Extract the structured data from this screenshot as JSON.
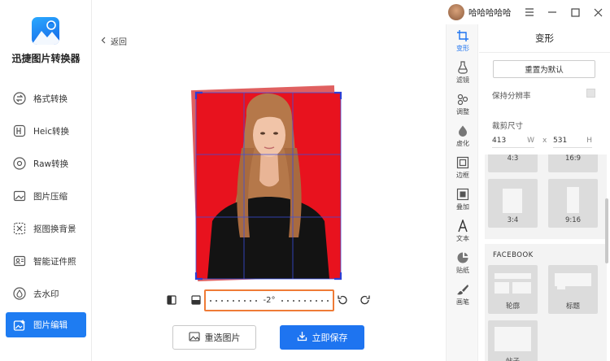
{
  "app": {
    "name": "迅捷图片转换器"
  },
  "sidebar": {
    "items": [
      {
        "label": "格式转换",
        "icon": "convert-icon"
      },
      {
        "label": "Heic转换",
        "icon": "heic-icon"
      },
      {
        "label": "Raw转换",
        "icon": "raw-icon"
      },
      {
        "label": "图片压缩",
        "icon": "compress-icon"
      },
      {
        "label": "抠图换背景",
        "icon": "cutout-icon"
      },
      {
        "label": "智能证件照",
        "icon": "id-photo-icon"
      },
      {
        "label": "去水印",
        "icon": "watermark-icon"
      },
      {
        "label": "图片编辑",
        "icon": "image-edit-icon"
      }
    ],
    "active_index": 7
  },
  "header": {
    "username": "哈哈哈哈哈"
  },
  "editor": {
    "back_label": "返回",
    "rotation_value": "-2°",
    "reselect_label": "重选图片",
    "save_label": "立即保存"
  },
  "tools": [
    {
      "label": "变形",
      "icon": "crop-icon",
      "active": true
    },
    {
      "label": "滤镜",
      "icon": "filter-icon"
    },
    {
      "label": "调整",
      "icon": "adjust-icon"
    },
    {
      "label": "虚化",
      "icon": "blur-icon"
    },
    {
      "label": "边框",
      "icon": "frame-icon"
    },
    {
      "label": "叠加",
      "icon": "overlay-icon"
    },
    {
      "label": "文本",
      "icon": "text-icon"
    },
    {
      "label": "贴纸",
      "icon": "sticker-icon"
    },
    {
      "label": "画笔",
      "icon": "brush-icon"
    }
  ],
  "panel": {
    "title": "变形",
    "reset_label": "重置为默认",
    "keep_resolution_label": "保持分辨率",
    "crop_size_label": "裁剪尺寸",
    "width_value": "413",
    "width_unit": "W",
    "separator": "x",
    "height_value": "531",
    "height_unit": "H",
    "ratios": [
      "4:3",
      "16:9",
      "3:4",
      "9:16"
    ],
    "facebook_label": "FACEBOOK",
    "facebook_items": [
      "轮廓",
      "标题",
      "帖子"
    ]
  },
  "colors": {
    "accent": "#1e74f0",
    "highlight": "#ef7b36",
    "photo_bg": "#e8121e"
  }
}
